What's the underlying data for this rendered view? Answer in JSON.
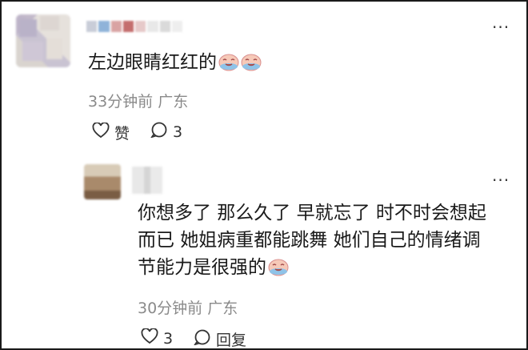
{
  "comment": {
    "text": "左边眼睛红红的",
    "emojis": [
      "crying-face-icon",
      "crying-face-icon"
    ],
    "time": "33分钟前",
    "location": "广东",
    "like_label": "赞",
    "reply_count": "3"
  },
  "reply": {
    "line1": "你想多了 那么久了 早就忘了 时不时会想起",
    "line2": "而已 她姐病重都能跳舞 她们自己的情绪调",
    "line3": "节能力是很强的",
    "emojis": [
      "crying-face-icon"
    ],
    "time": "30分钟前",
    "location": "广东",
    "like_count": "3",
    "reply_label": "回复"
  },
  "more_glyph": "···",
  "colors": {
    "text": "#1a1a1a",
    "meta": "#8a8a8a",
    "emoji_face": "#f2a7a7"
  }
}
